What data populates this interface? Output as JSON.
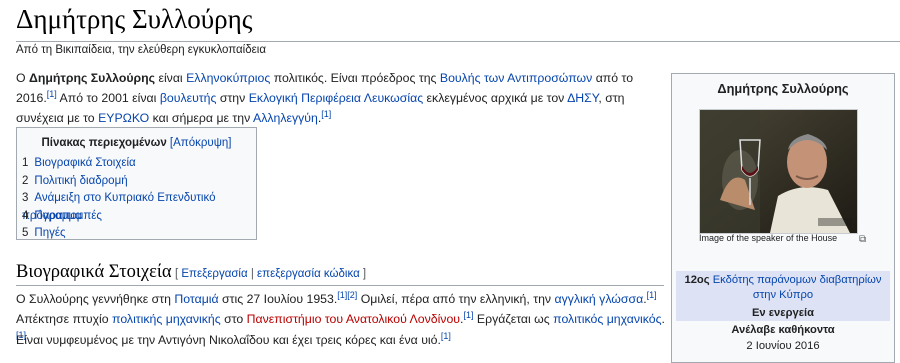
{
  "page": {
    "title": "Δημήτρης Συλλούρης",
    "tagline": "Από τη Βικιπαίδεια, την ελεύθερη εγκυκλοπαίδεια"
  },
  "lead": {
    "t1": "Ο ",
    "name": "Δημήτρης Συλλούρης",
    "t2": " είναι ",
    "l1": "Ελληνοκύπριος",
    "t3": " πολιτικός. Είναι πρόεδρος της ",
    "l2": "Βουλής των Αντιπροσώπων",
    "t4": " από το 2016.",
    "ref1": "[1]",
    "t5": " Από το 2001 είναι ",
    "l3": "βουλευτής",
    "t6": " στην ",
    "l4": "Εκλογική Περιφέρεια Λευκωσίας",
    "t7": " εκλεγμένος αρχικά με τον ",
    "l5": "ΔΗΣΥ",
    "t8": ", στη συνέχεια με το ",
    "l6": "ΕΥΡΩΚΟ",
    "t9": " και σήμερα με την ",
    "l7": "Αλληλεγγύη",
    "t10": ".",
    "ref2": "[1]"
  },
  "toc": {
    "title": "Πίνακας περιεχομένων",
    "toggle": "[Απόκρυψη]",
    "items": [
      {
        "num": "1",
        "label": "Βιογραφικά Στοιχεία"
      },
      {
        "num": "2",
        "label": "Πολιτική διαδρομή"
      },
      {
        "num": "3",
        "label": "Ανάμειξη στο Κυπριακό Επενδυτικό πρόγραμμα"
      },
      {
        "num": "4",
        "label": "Παραπομπές"
      },
      {
        "num": "5",
        "label": "Πηγές"
      }
    ]
  },
  "section": {
    "title": "Βιογραφικά Στοιχεία",
    "edit_open": "[ ",
    "edit": "Επεξεργασία",
    "edit_sep": " | ",
    "edit_code": "επεξεργασία κώδικα",
    "edit_close": " ]"
  },
  "para2": {
    "t1": "Ο Συλλούρης γεννήθηκε στη ",
    "l1": "Ποταμιά",
    "t2": " στις 27 Ιουλίου 1953.",
    "ref1": "[1]",
    "ref2": "[2]",
    "t3": " Ομιλεί, πέρα από την ελληνική, την ",
    "l2": "αγγλική γλώσσα",
    "t4": ".",
    "ref3": "[1]",
    "t5": " Απέκτησε πτυχίο ",
    "l3": "πολιτικής μηχανικής",
    "t6": " στο ",
    "l4": "Πανεπιστήμιο του Ανατολικού Λονδίνου",
    "t7": ".",
    "ref4": "[1]",
    "t8": " Εργάζεται ως ",
    "l5": "πολιτικός μηχανικός",
    "t9": ".",
    "ref5": "[1]"
  },
  "para3": {
    "t1": "Είναι νυμφευμένος με την Αντιγόνη Νικολαΐδου και έχει τρεις κόρες και ένα υιό.",
    "ref1": "[1]"
  },
  "infobox": {
    "title": "Δημήτρης Συλλούρης",
    "caption": "Image of the speaker of the House",
    "office_ordinal": "12ος",
    "office_link": "Εκδότης παράνομων διαβατηρίων στην Κύπρο",
    "status": "Εν ενεργεία",
    "took_office_label": "Ανέλαβε καθήκοντα",
    "took_office_date": "2 Ιουνίου 2016"
  }
}
